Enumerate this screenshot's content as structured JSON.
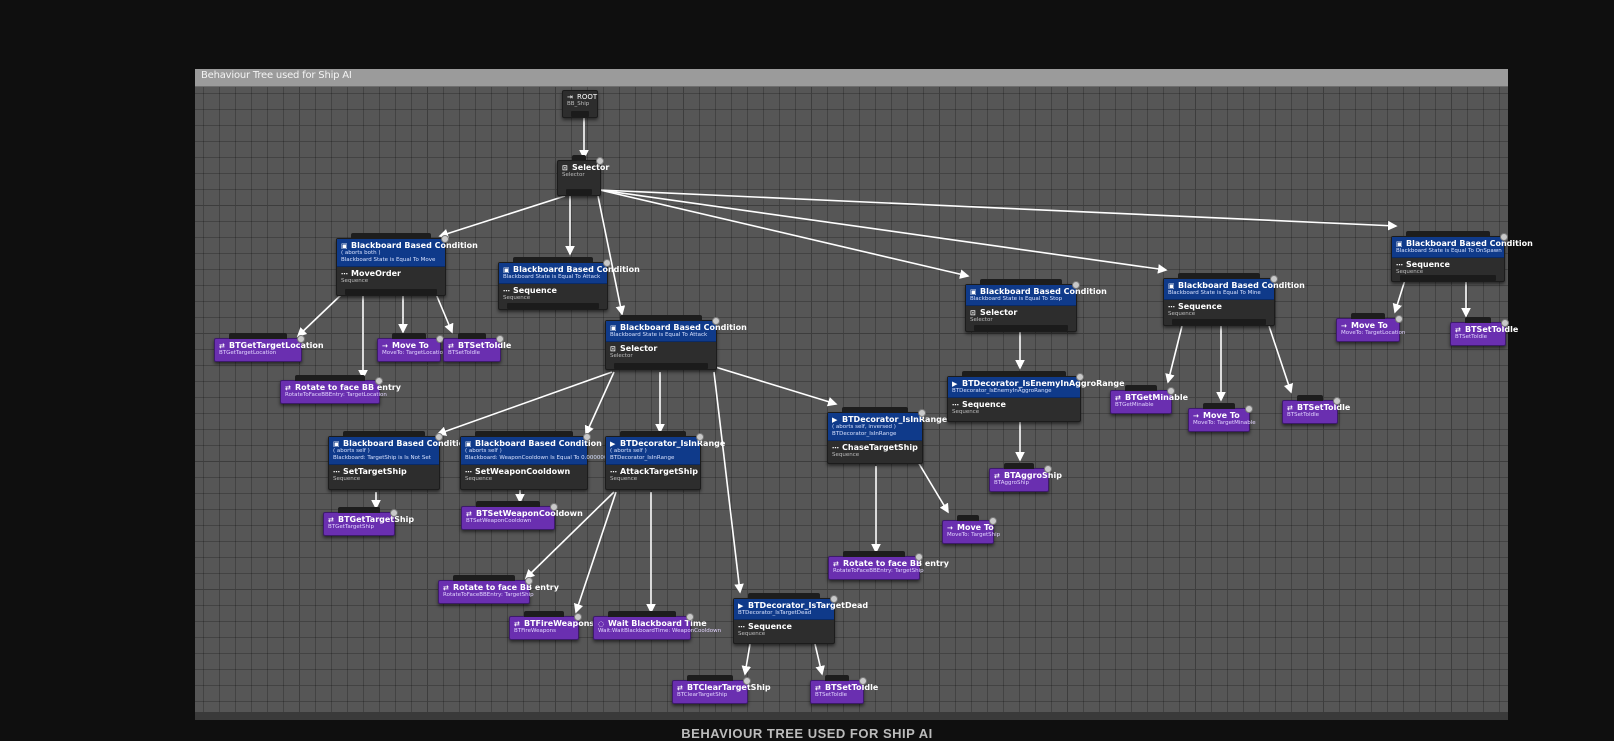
{
  "window": {
    "title": "Behaviour Tree used for Ship AI"
  },
  "caption": "BEHAVIOUR TREE USED FOR SHIP AI",
  "colors": {
    "decorator": "#0f3a8a",
    "task": "#6a2fb0",
    "composite": "#2d2d2d",
    "graph_bg": "#565656",
    "wire": "#ffffff"
  },
  "nodes": {
    "root": {
      "title": "ROOT",
      "sub": "BB_Ship"
    },
    "selector_main": {
      "title": "Selector",
      "sub": "Selector"
    },
    "move_order": {
      "dec_title": "Blackboard Based Condition",
      "dec_s1": "( aborts both )",
      "dec_s2": "Blackboard State is Equal To Move",
      "title": "MoveOrder",
      "sub": "Sequence"
    },
    "attack_seq": {
      "dec_title": "Blackboard Based Condition",
      "dec_s1": "Blackboard State is Equal To Attack",
      "title": "Sequence",
      "sub": "Sequence"
    },
    "attack_sel": {
      "dec_title": "Blackboard Based Condition",
      "dec_s1": "Blackboard State is Equal To Attack",
      "title": "Selector",
      "sub": "Selector"
    },
    "stop": {
      "dec_title": "Blackboard Based Condition",
      "dec_s1": "Blackboard State is Equal To Stop",
      "title": "Selector",
      "sub": "Selector"
    },
    "mine": {
      "dec_title": "Blackboard Based Condition",
      "dec_s1": "Blackboard State is Equal To Mine",
      "title": "Sequence",
      "sub": "Sequence"
    },
    "spawn": {
      "dec_title": "Blackboard Based Condition",
      "dec_s1": "Blackboard State is Equal To OnSpawn",
      "title": "Sequence",
      "sub": "Sequence"
    },
    "get_target_loc": {
      "title": "BTGetTargetLocation",
      "sub": "BTGetTargetLocation"
    },
    "moveto_loc": {
      "title": "Move To",
      "sub": "MoveTo: TargetLocation"
    },
    "set_idle_1": {
      "title": "BTSetToIdle",
      "sub": "BTSetToIdle"
    },
    "rotate_loc": {
      "title": "Rotate to face BB entry",
      "sub": "RotateToFaceBBEntry: TargetLocation"
    },
    "set_target": {
      "dec_title": "Blackboard Based Condition",
      "dec_s1": "( aborts self )",
      "dec_s2": "Blackboard: TargetShip is Is Not Set",
      "title": "SetTargetShip",
      "sub": "Sequence"
    },
    "weapon_cd": {
      "dec_title": "Blackboard Based Condition",
      "dec_s1": "( aborts self )",
      "dec_s2": "Blackboard: WeaponCooldown Is Equal To 0.000000",
      "title": "SetWeaponCooldown",
      "sub": "Sequence"
    },
    "attack_target": {
      "dec_title": "BTDecorator_IsInRange",
      "dec_s1": "( aborts self )",
      "dec_s2": "BTDecorator_IsInRange",
      "title": "AttackTargetShip",
      "sub": "Sequence"
    },
    "chase": {
      "dec_title": "BTDecorator_IsInRange",
      "dec_s1": "( aborts self, inversed )",
      "dec_s2": "BTDecorator_IsInRange",
      "title": "ChaseTargetShip",
      "sub": "Sequence"
    },
    "aggro": {
      "dec_title": "BTDecorator_IsEnemyInAggroRange",
      "dec_s1": "BTDecorator_IsEnemyInAggroRange",
      "title": "Sequence",
      "sub": "Sequence"
    },
    "get_target_ship": {
      "title": "BTGetTargetShip",
      "sub": "BTGetTargetShip"
    },
    "set_weapon_cd": {
      "title": "BTSetWeaponCooldown",
      "sub": "BTSetWeaponCooldown"
    },
    "rotate_ship_a": {
      "title": "Rotate to face BB entry",
      "sub": "RotateToFaceBBEntry: TargetShip"
    },
    "fire": {
      "title": "BTFireWeapons",
      "sub": "BTFireWeapons"
    },
    "wait": {
      "title": "Wait Blackboard Time",
      "sub": "Wait:WaitBlackboardTime: WeaponCooldown"
    },
    "target_dead": {
      "dec_title": "BTDecorator_IsTargetDead",
      "dec_s1": "BTDecorator_IsTargetDead",
      "title": "Sequence",
      "sub": "Sequence"
    },
    "clear_target": {
      "title": "BTClearTargetShip",
      "sub": "BTClearTargetShip"
    },
    "set_idle_2": {
      "title": "BTSetToIdle",
      "sub": "BTSetToIdle"
    },
    "rotate_ship_b": {
      "title": "Rotate to face BB entry",
      "sub": "RotateToFaceBBEntry: TargetShip"
    },
    "moveto_ship": {
      "title": "Move To",
      "sub": "MoveTo: TargetShip"
    },
    "aggro_ship": {
      "title": "BTAggroShip",
      "sub": "BTAggroShip"
    },
    "get_minable": {
      "title": "BTGetMinable",
      "sub": "BTGetMinable"
    },
    "moveto_minable": {
      "title": "Move To",
      "sub": "MoveTo: TargetMinable"
    },
    "set_idle_3": {
      "title": "BTSetToIdle",
      "sub": "BTSetToIdle"
    },
    "moveto_loc_2": {
      "title": "Move To",
      "sub": "MoveTo: TargetLocation"
    },
    "set_idle_4": {
      "title": "BTSetToIdle",
      "sub": "BTSetToIdle"
    }
  }
}
